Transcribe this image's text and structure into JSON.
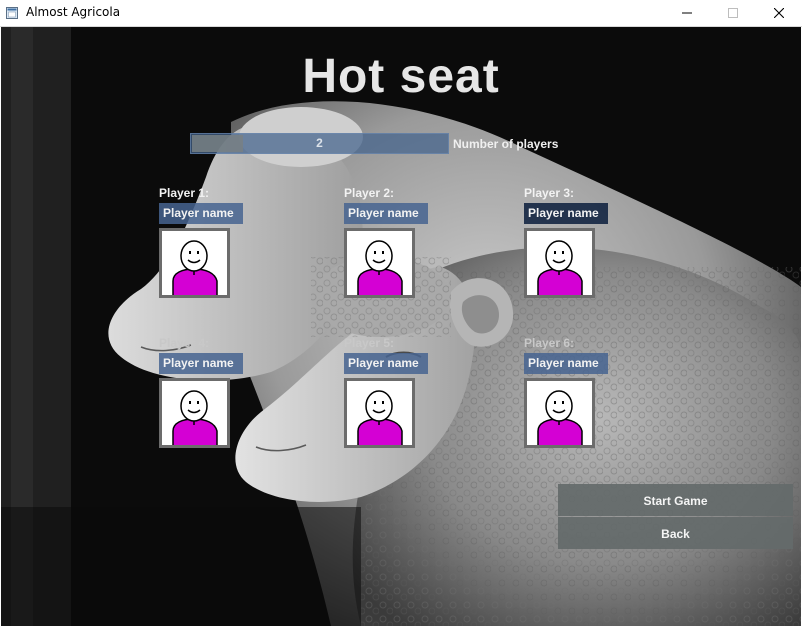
{
  "window": {
    "title": "Almost Agricola",
    "icons": {
      "app": "app-window-icon",
      "minimize": "minimize-icon",
      "maximize": "maximize-icon",
      "close": "close-icon"
    }
  },
  "screen": {
    "heading": "Hot seat",
    "player_count": {
      "value": "2",
      "label": "Number of players",
      "fill_fraction": 0.2
    },
    "players": [
      {
        "label": "Player 1:",
        "placeholder": "Player name",
        "avatar": "player-avatar-icon"
      },
      {
        "label": "Player 2:",
        "placeholder": "Player name",
        "avatar": "player-avatar-icon"
      },
      {
        "label": "Player 3:",
        "placeholder": "Player name",
        "avatar": "player-avatar-icon"
      },
      {
        "label": "Player 4:",
        "placeholder": "Player name",
        "avatar": "player-avatar-icon"
      },
      {
        "label": "Player 5:",
        "placeholder": "Player name",
        "avatar": "player-avatar-icon"
      },
      {
        "label": "Player 6:",
        "placeholder": "Player name",
        "avatar": "player-avatar-icon"
      }
    ],
    "buttons": {
      "start": "Start Game",
      "back": "Back"
    },
    "colors": {
      "avatar_shirt": "#d400d4",
      "name_field": "#46648f",
      "button": "#646a6a"
    }
  }
}
